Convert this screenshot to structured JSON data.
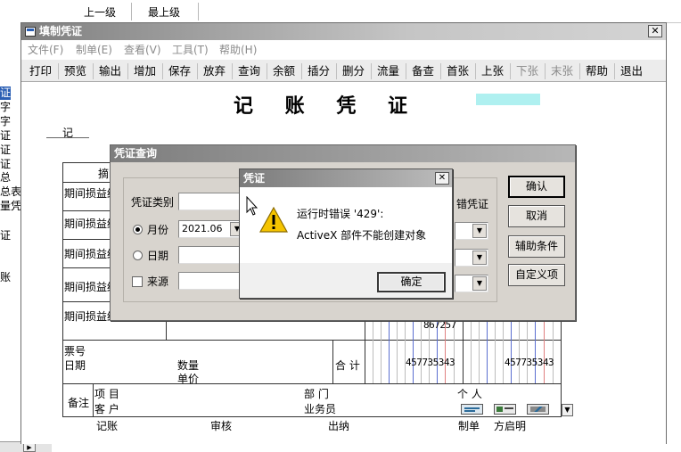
{
  "background": {
    "toolbar": {
      "up_label": "上一级",
      "top_label": "最上级"
    },
    "left_panel": {
      "items": [
        "证",
        "字",
        "字",
        "证",
        "证",
        "证",
        "总",
        "总表",
        "量凭",
        "证",
        "账"
      ]
    }
  },
  "main_window": {
    "title": "填制凭证",
    "menu": [
      "文件(F)",
      "制单(E)",
      "查看(V)",
      "工具(T)",
      "帮助(H)"
    ],
    "toolbar": [
      {
        "label": "打印",
        "enabled": true
      },
      {
        "label": "预览",
        "enabled": true
      },
      {
        "label": "输出",
        "enabled": true
      },
      {
        "label": "增加",
        "enabled": true
      },
      {
        "label": "保存",
        "enabled": true
      },
      {
        "label": "放弃",
        "enabled": true
      },
      {
        "label": "查询",
        "enabled": true
      },
      {
        "label": "余额",
        "enabled": true
      },
      {
        "label": "插分",
        "enabled": true
      },
      {
        "label": "删分",
        "enabled": true
      },
      {
        "label": "流量",
        "enabled": true
      },
      {
        "label": "备查",
        "enabled": true
      },
      {
        "label": "首张",
        "enabled": true
      },
      {
        "label": "上张",
        "enabled": true
      },
      {
        "label": "下张",
        "enabled": false
      },
      {
        "label": "末张",
        "enabled": false
      },
      {
        "label": "帮助",
        "enabled": true
      },
      {
        "label": "退出",
        "enabled": true
      }
    ]
  },
  "voucher": {
    "title": "记 账 凭 证",
    "type_label": "记",
    "summary_header": "摘",
    "rows": [
      "期间损益结",
      "期间损益结",
      "期间损益结",
      "期间损益结",
      "期间损益结"
    ],
    "partial_amount": "867257",
    "ticket_label": "票号",
    "date_label": "日期",
    "qty_label": "数量",
    "price_label": "单价",
    "total_label": "合 计",
    "total_debit": "457735343",
    "total_credit": "457735343",
    "notes_label": "备注",
    "project_label": "项 目",
    "customer_label": "客 户",
    "dept_label": "部 门",
    "staff_label": "业务员",
    "person_label": "个 人",
    "footer": {
      "bookkeeping": "记账",
      "audit": "审核",
      "cashier": "出纳",
      "maker_label": "制单",
      "maker_name": "方启明"
    }
  },
  "query_dialog": {
    "title": "凭证查询",
    "type_label": "凭证类别",
    "month_label": "月份",
    "month_value": "2021.06",
    "date_label": "日期",
    "source_label": "来源",
    "error_voucher_label": "错凭证",
    "buttons": [
      "确认",
      "取消",
      "辅助条件",
      "自定义项"
    ]
  },
  "error_dialog": {
    "title": "凭证",
    "line1": "运行时错误 '429':",
    "line2": "ActiveX 部件不能创建对象",
    "ok_label": "确定"
  }
}
